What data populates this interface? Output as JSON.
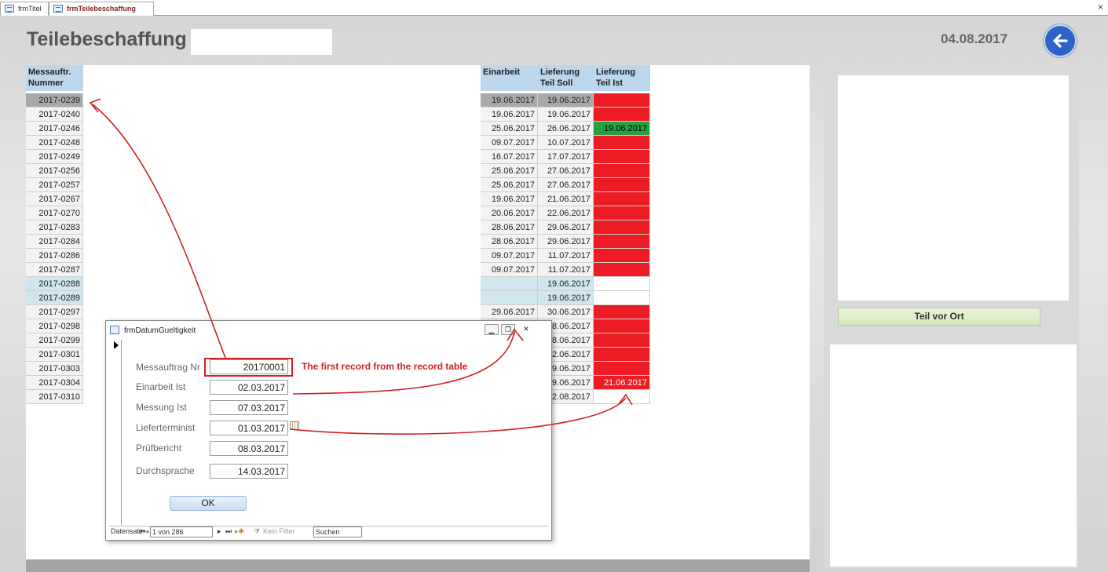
{
  "tabs": [
    {
      "label": "frmTitel"
    },
    {
      "label": "frmTeilebeschaffung"
    }
  ],
  "close_glyph": "×",
  "header": {
    "title": "Teilebeschaffung",
    "date": "04.08.2017",
    "back_icon": "back-arrow-icon"
  },
  "table": {
    "headers": {
      "nummer": "Messauftr. Nummer",
      "einarbeit": "Einarbeit",
      "soll": "Lieferung Teil Soll",
      "ist": "Lieferung Teil Ist"
    },
    "rows": [
      {
        "nummer": "2017-0239",
        "einarbeit": "19.06.2017",
        "soll": "19.06.2017",
        "ist": "",
        "state": "selected",
        "ist_color": "red"
      },
      {
        "nummer": "2017-0240",
        "einarbeit": "19.06.2017",
        "soll": "19.06.2017",
        "ist": "",
        "state": "",
        "ist_color": "red"
      },
      {
        "nummer": "2017-0246",
        "einarbeit": "25.06.2017",
        "soll": "26.06.2017",
        "ist": "19.06.2017",
        "state": "",
        "ist_color": "green"
      },
      {
        "nummer": "2017-0248",
        "einarbeit": "09.07.2017",
        "soll": "10.07.2017",
        "ist": "",
        "state": "",
        "ist_color": "red"
      },
      {
        "nummer": "2017-0249",
        "einarbeit": "16.07.2017",
        "soll": "17.07.2017",
        "ist": "",
        "state": "",
        "ist_color": "red"
      },
      {
        "nummer": "2017-0256",
        "einarbeit": "25.06.2017",
        "soll": "27.06.2017",
        "ist": "",
        "state": "",
        "ist_color": "red"
      },
      {
        "nummer": "2017-0257",
        "einarbeit": "25.06.2017",
        "soll": "27.06.2017",
        "ist": "",
        "state": "",
        "ist_color": "red"
      },
      {
        "nummer": "2017-0267",
        "einarbeit": "19.06.2017",
        "soll": "21.06.2017",
        "ist": "",
        "state": "",
        "ist_color": "red"
      },
      {
        "nummer": "2017-0270",
        "einarbeit": "20.06.2017",
        "soll": "22.06.2017",
        "ist": "",
        "state": "",
        "ist_color": "red"
      },
      {
        "nummer": "2017-0283",
        "einarbeit": "28.06.2017",
        "soll": "29.06.2017",
        "ist": "",
        "state": "",
        "ist_color": "red"
      },
      {
        "nummer": "2017-0284",
        "einarbeit": "28.06.2017",
        "soll": "29.06.2017",
        "ist": "",
        "state": "",
        "ist_color": "red"
      },
      {
        "nummer": "2017-0286",
        "einarbeit": "09.07.2017",
        "soll": "11.07.2017",
        "ist": "",
        "state": "",
        "ist_color": "red"
      },
      {
        "nummer": "2017-0287",
        "einarbeit": "09.07.2017",
        "soll": "11.07.2017",
        "ist": "",
        "state": "",
        "ist_color": "red"
      },
      {
        "nummer": "2017-0288",
        "einarbeit": "",
        "soll": "19.06.2017",
        "ist": "",
        "state": "blue",
        "ist_color": "white"
      },
      {
        "nummer": "2017-0289",
        "einarbeit": "",
        "soll": "19.06.2017",
        "ist": "",
        "state": "blue",
        "ist_color": "white"
      },
      {
        "nummer": "2017-0297",
        "einarbeit": "29.06.2017",
        "soll": "30.06.2017",
        "ist": "",
        "state": "",
        "ist_color": "red"
      },
      {
        "nummer": "2017-0298",
        "einarbeit": "",
        "soll": "28.06.2017",
        "ist": "",
        "state": "",
        "ist_color": "red"
      },
      {
        "nummer": "2017-0299",
        "einarbeit": "",
        "soll": "28.06.2017",
        "ist": "",
        "state": "",
        "ist_color": "red"
      },
      {
        "nummer": "2017-0301",
        "einarbeit": "",
        "soll": "22.06.2017",
        "ist": "",
        "state": "",
        "ist_color": "red"
      },
      {
        "nummer": "2017-0303",
        "einarbeit": "",
        "soll": "29.06.2017",
        "ist": "",
        "state": "",
        "ist_color": "red"
      },
      {
        "nummer": "2017-0304",
        "einarbeit": "",
        "soll": "29.06.2017",
        "ist": "21.06.2017",
        "state": "",
        "ist_color": "red"
      },
      {
        "nummer": "2017-0310",
        "einarbeit": "",
        "soll": "02.08.2017",
        "ist": "",
        "state": "",
        "ist_color": "white"
      }
    ]
  },
  "right_panel": {
    "teil_vor_ort_label": "Teil vor Ort"
  },
  "popup": {
    "title": "frmDatumGueltigkeit",
    "fields": [
      {
        "label": "Messauftrag Nr",
        "value": "20170001"
      },
      {
        "label": "Einarbeit Ist",
        "value": "02.03.2017"
      },
      {
        "label": "Messung Ist",
        "value": "07.03.2017"
      },
      {
        "label": "Lieferterminist",
        "value": "01.03.2017"
      },
      {
        "label": "Prüfbericht",
        "value": "08.03.2017"
      },
      {
        "label": "Durchsprache",
        "value": "14.03.2017"
      }
    ],
    "ok_label": "OK",
    "navbar": {
      "prefix": "Datensatz:",
      "record": "1 von 286",
      "filter": "Kein Filter",
      "search": "Suchen"
    }
  },
  "annotation": {
    "text": "The first record from the record table",
    "color": "#d32020"
  },
  "colors": {
    "header_blue": "#bcd6ec",
    "cell_red": "#ed1c24",
    "cell_green": "#27a243",
    "back_button": "#2f62c7"
  }
}
